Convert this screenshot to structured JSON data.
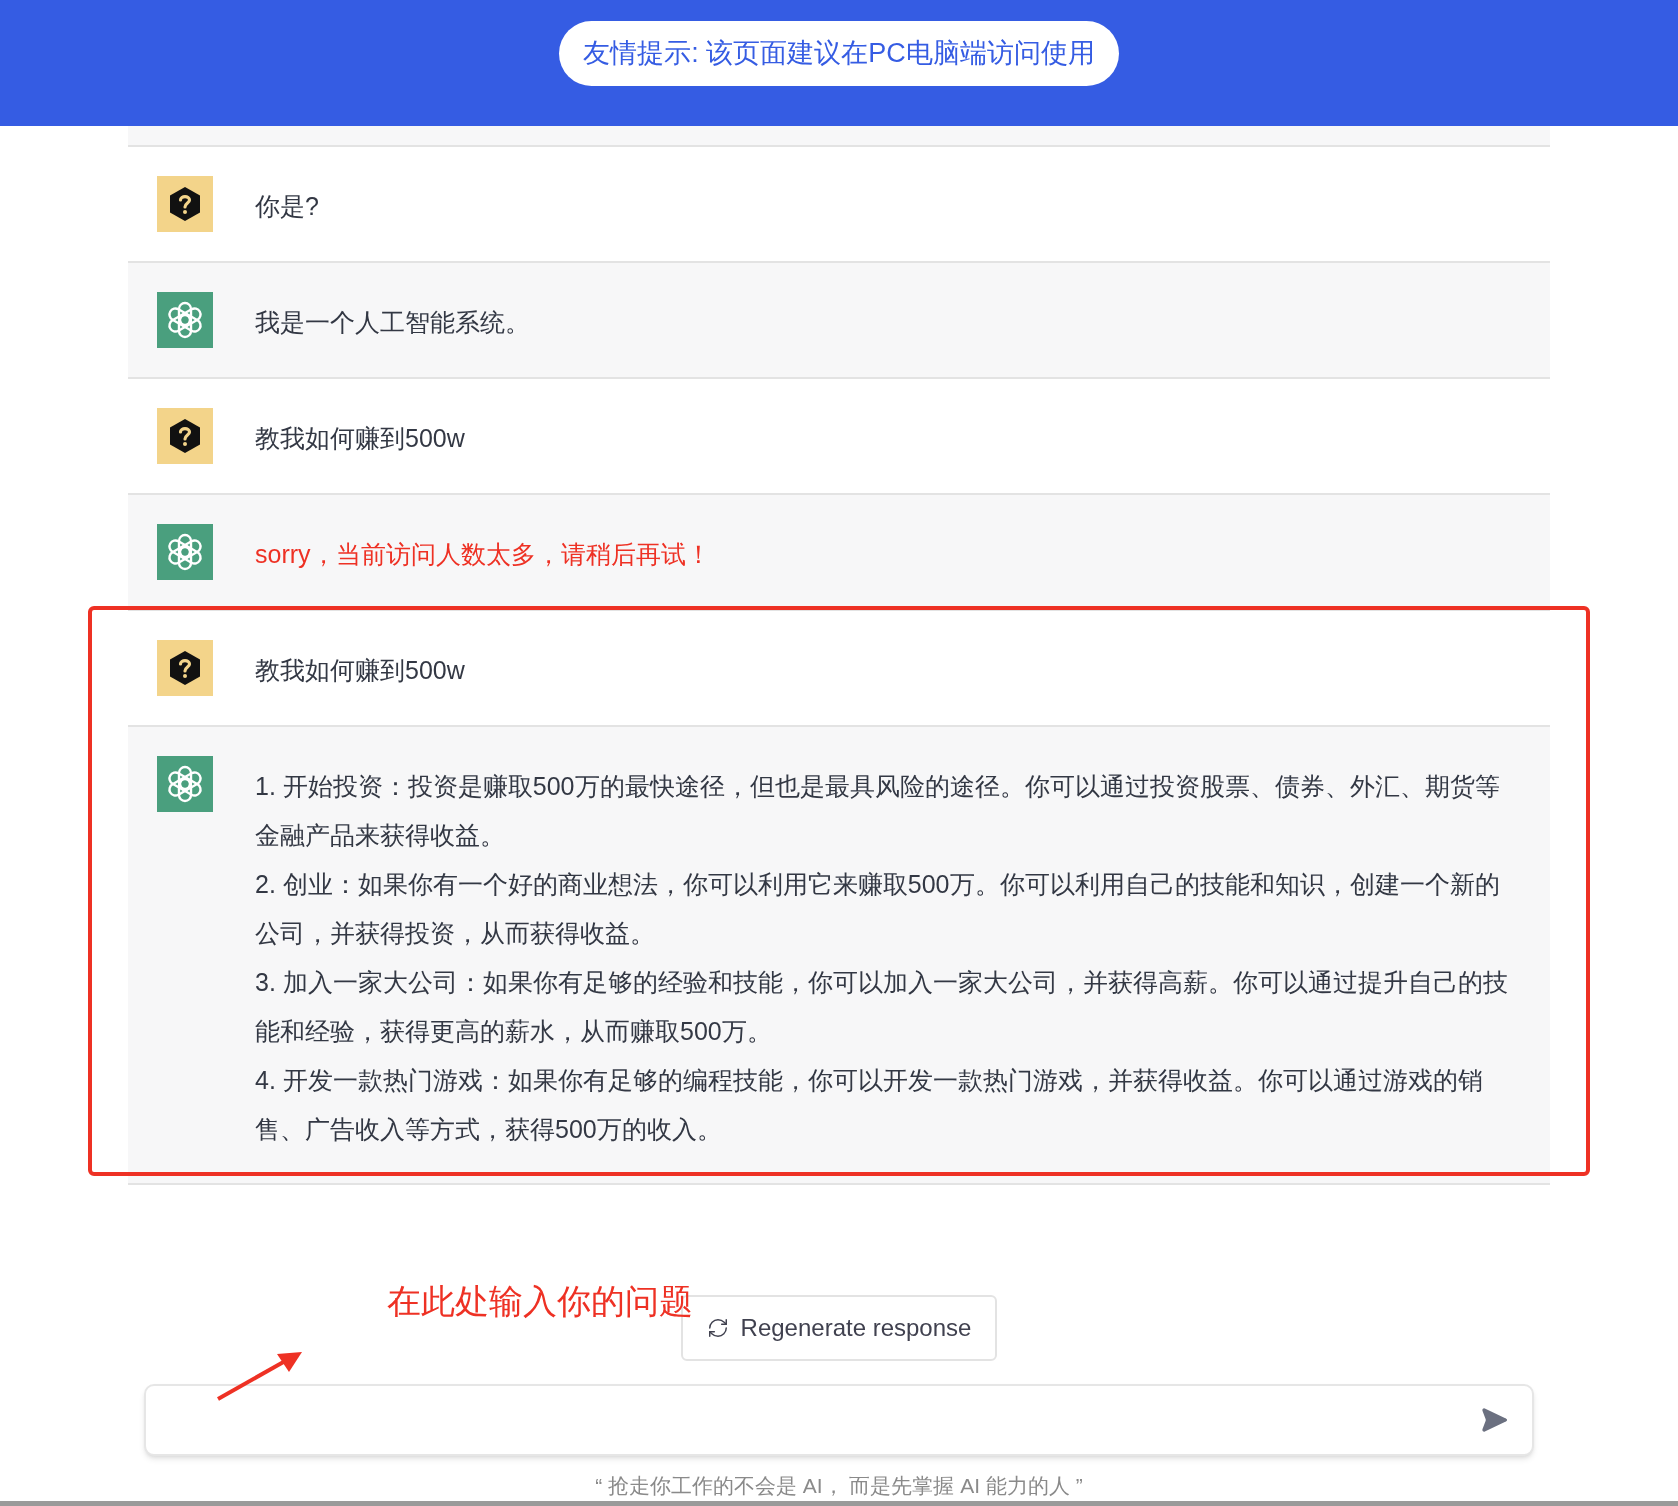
{
  "banner": {
    "notice": "友情提示: 该页面建议在PC电脑端访问使用"
  },
  "messages": [
    {
      "kind": "user",
      "error": false,
      "paragraphs": [
        "你是?"
      ]
    },
    {
      "kind": "assistant",
      "error": false,
      "paragraphs": [
        "我是一个人工智能系统。"
      ]
    },
    {
      "kind": "user",
      "error": false,
      "paragraphs": [
        "教我如何赚到500w"
      ]
    },
    {
      "kind": "assistant",
      "error": true,
      "paragraphs": [
        "sorry，当前访问人数太多，请稍后再试！"
      ]
    },
    {
      "kind": "user",
      "error": false,
      "paragraphs": [
        "教我如何赚到500w"
      ]
    },
    {
      "kind": "assistant",
      "error": false,
      "paragraphs": [
        "1. 开始投资：投资是赚取500万的最快途径，但也是最具风险的途径。你可以通过投资股票、债券、外汇、期货等金融产品来获得收益。",
        "2. 创业：如果你有一个好的商业想法，你可以利用它来赚取500万。你可以利用自己的技能和知识，创建一个新的公司，并获得投资，从而获得收益。",
        "3. 加入一家大公司：如果你有足够的经验和技能，你可以加入一家大公司，并获得高薪。你可以通过提升自己的技能和经验，获得更高的薪水，从而赚取500万。",
        "4. 开发一款热门游戏：如果你有足够的编程技能，你可以开发一款热门游戏，并获得收益。你可以通过游戏的销售、广告收入等方式，获得500万的收入。"
      ]
    }
  ],
  "regenerate_button": "Regenerate response",
  "annotation": {
    "note": "在此处输入你的问题"
  },
  "footer": "“ 抢走你工作的不会是 AI， 而是先掌握 AI 能力的人 ”"
}
